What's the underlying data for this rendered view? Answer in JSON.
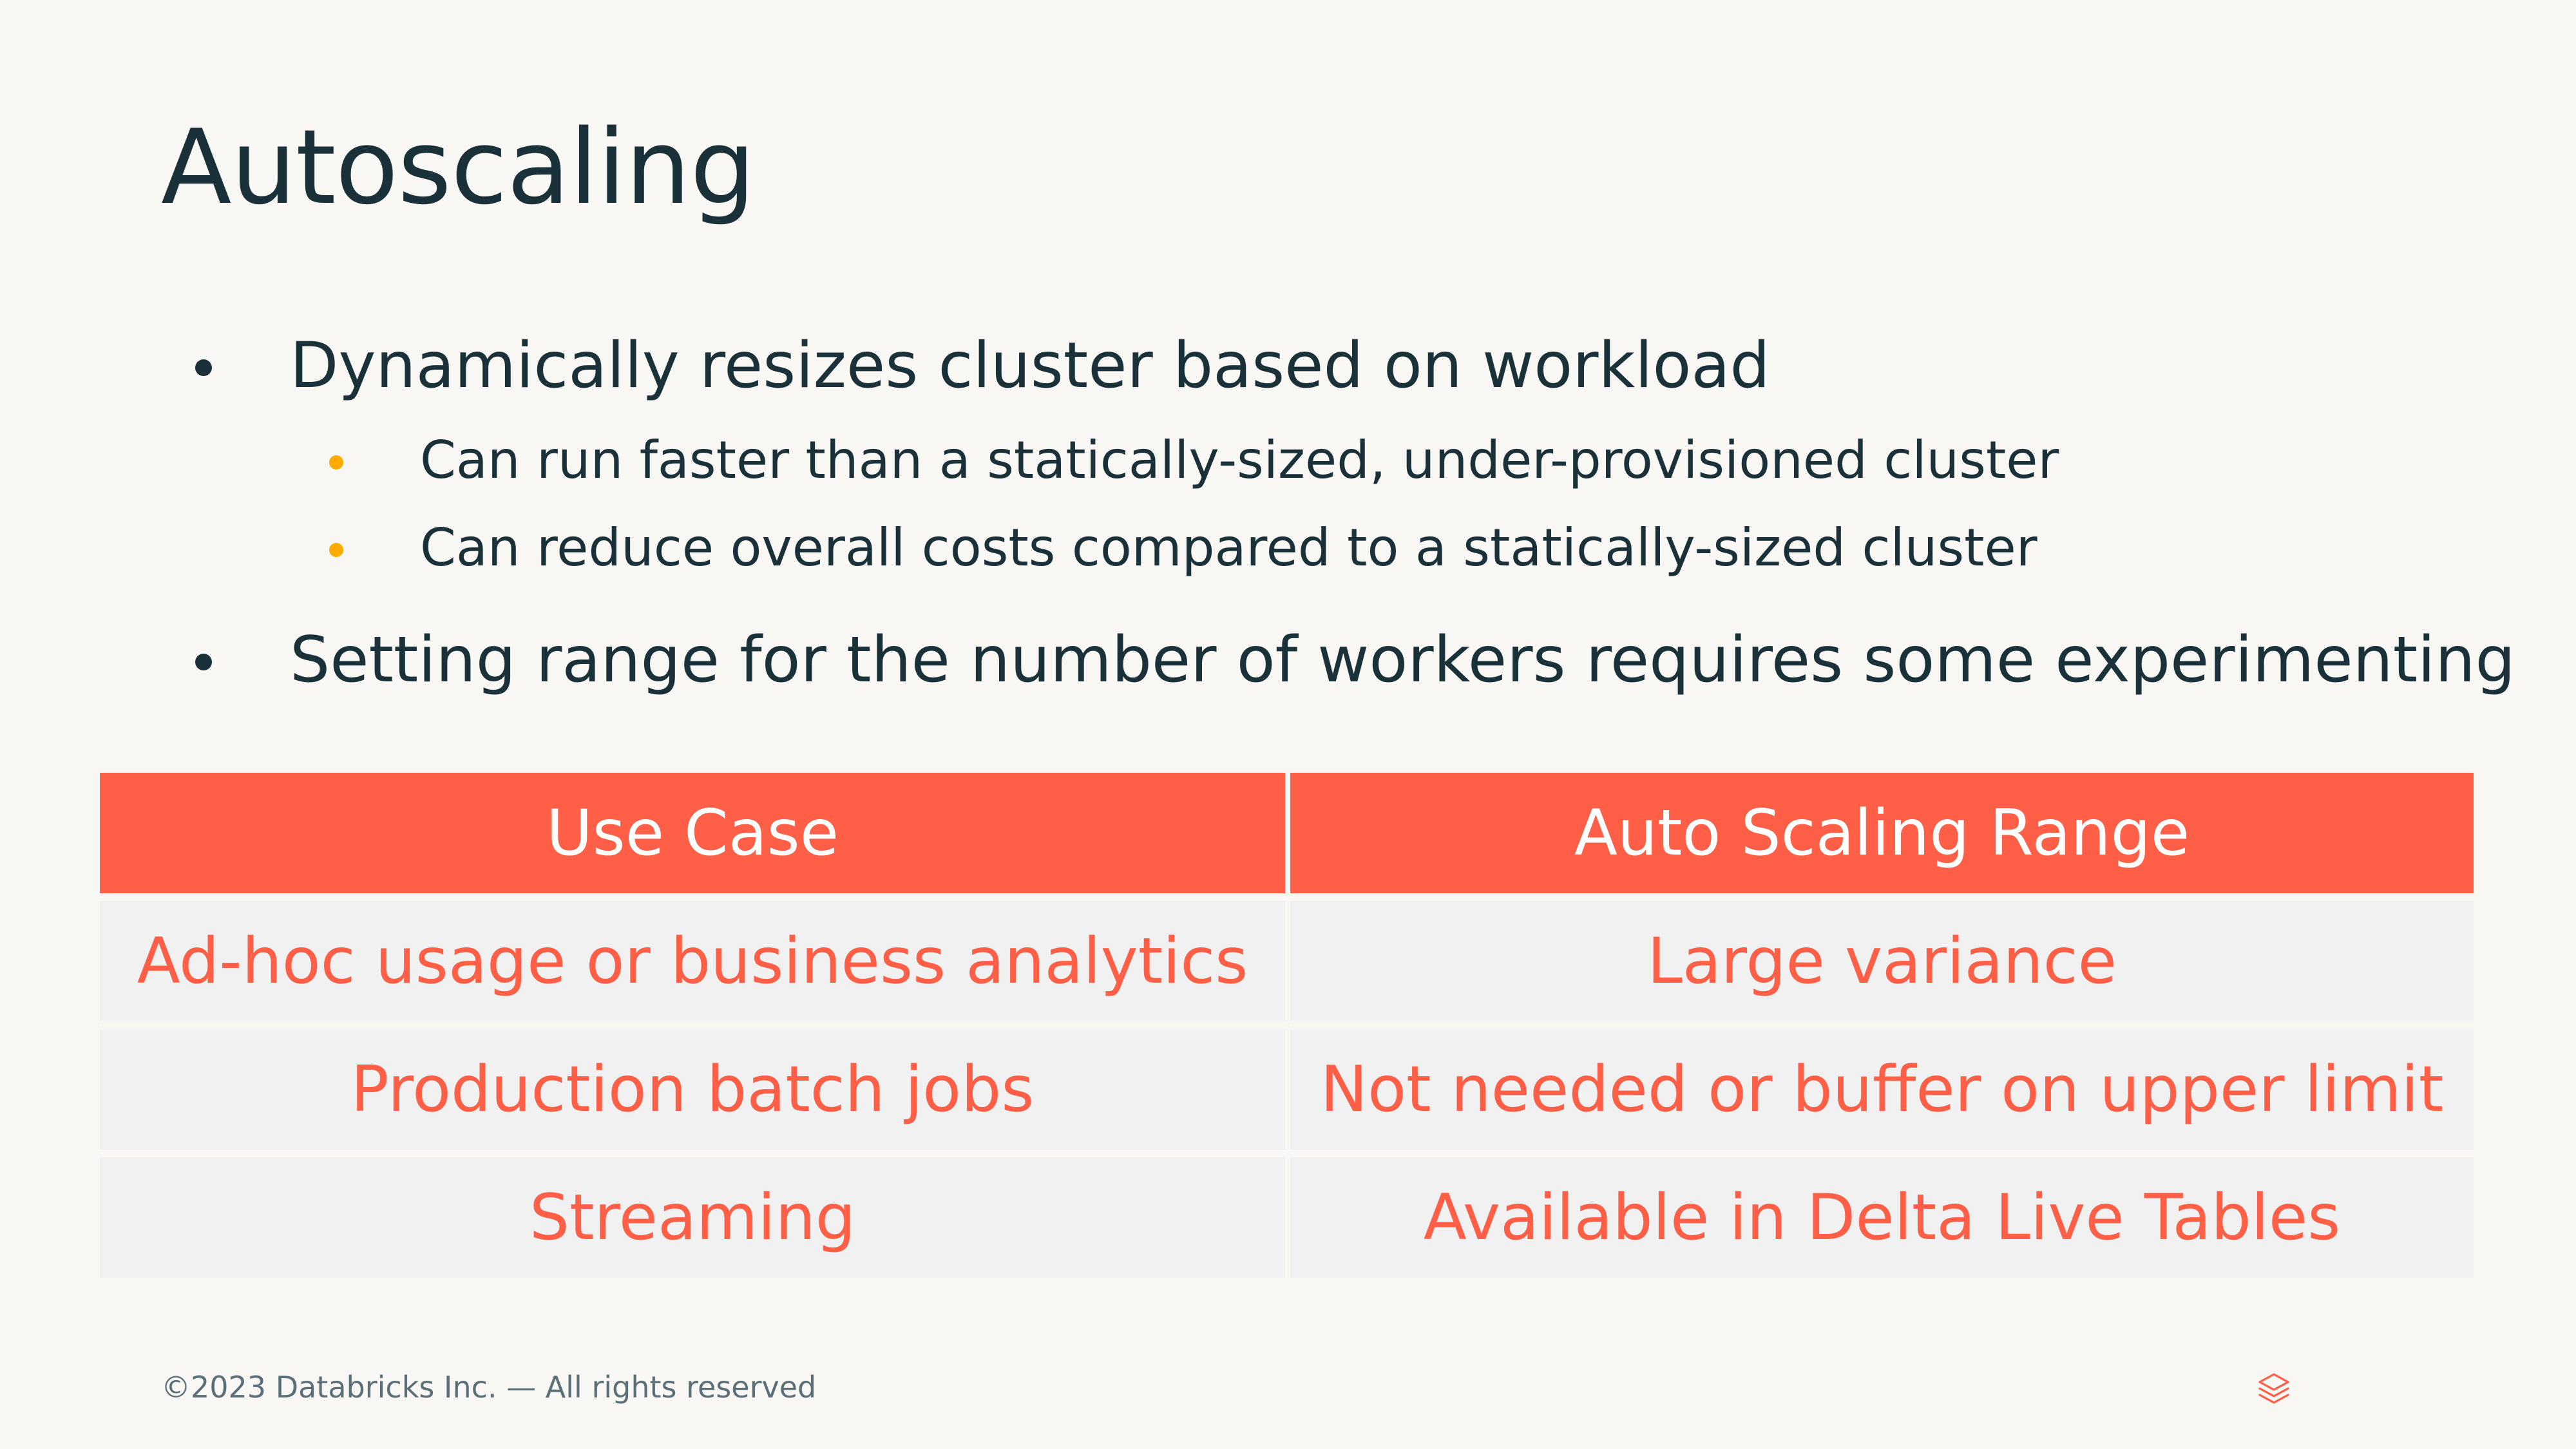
{
  "slide": {
    "title": "Autoscaling",
    "bullets": [
      "Dynamically resizes cluster based on workload",
      "Setting range for the number of workers requires some experimenting"
    ],
    "sub_bullets": [
      "Can run faster than a statically-sized, under-provisioned cluster",
      "Can reduce overall costs compared to a statically-sized cluster"
    ]
  },
  "table": {
    "headers": [
      "Use Case",
      "Auto Scaling Range"
    ],
    "rows": [
      [
        "Ad-hoc usage or business analytics",
        "Large variance"
      ],
      [
        "Production batch jobs",
        "Not needed or buffer on upper limit"
      ],
      [
        "Streaming",
        "Available in Delta Live Tables"
      ]
    ]
  },
  "footer": {
    "copyright": "©2023 Databricks Inc. — All rights reserved",
    "logo_icon": "databricks-logo-icon"
  },
  "colors": {
    "background": "#F8F7F4",
    "text": "#1B3139",
    "accent": "#FF5F46",
    "sub_bullet": "#FFAB00",
    "table_body": "#F1F1F1",
    "footer_text": "#5A6F77"
  }
}
